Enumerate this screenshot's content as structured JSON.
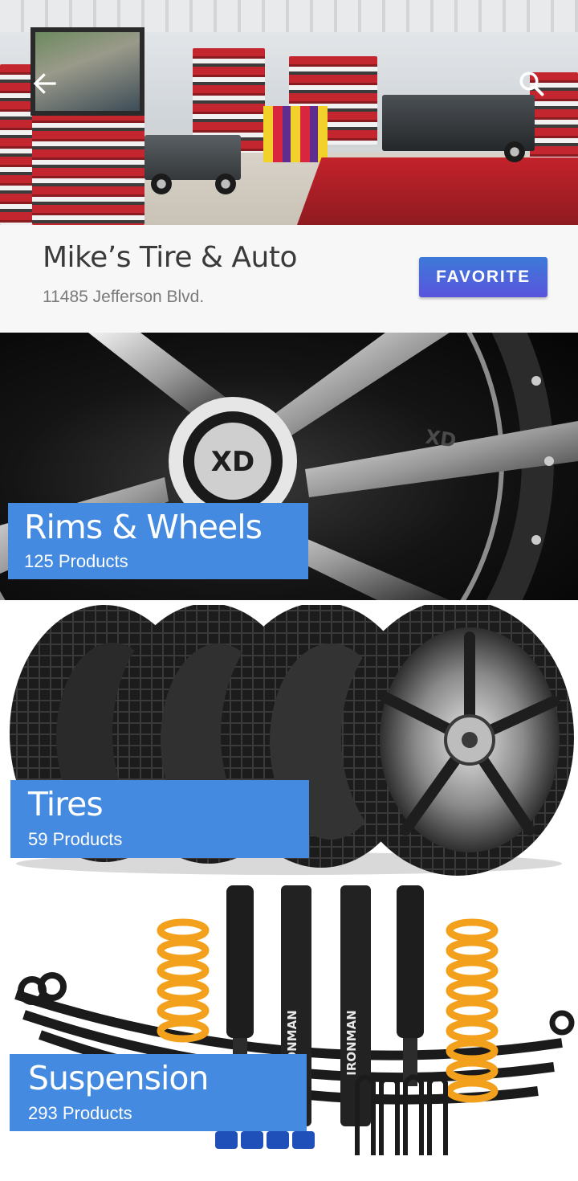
{
  "header": {
    "back_icon": "arrow-left-icon",
    "search_icon": "search-icon"
  },
  "store": {
    "name": "Mike’s Tire & Auto",
    "address": "11485 Jefferson Blvd.",
    "favorite_label": "FAVORITE"
  },
  "categories": [
    {
      "title": "Rims & Wheels",
      "count": "125 Products"
    },
    {
      "title": "Tires",
      "count": "59 Products"
    },
    {
      "title": "Suspension",
      "count": "293 Products"
    }
  ],
  "colors": {
    "label_blue": "#448ae0",
    "button_start": "#3d7ad8",
    "button_end": "#5a55dd",
    "store_bar": "#f7f7f7"
  }
}
